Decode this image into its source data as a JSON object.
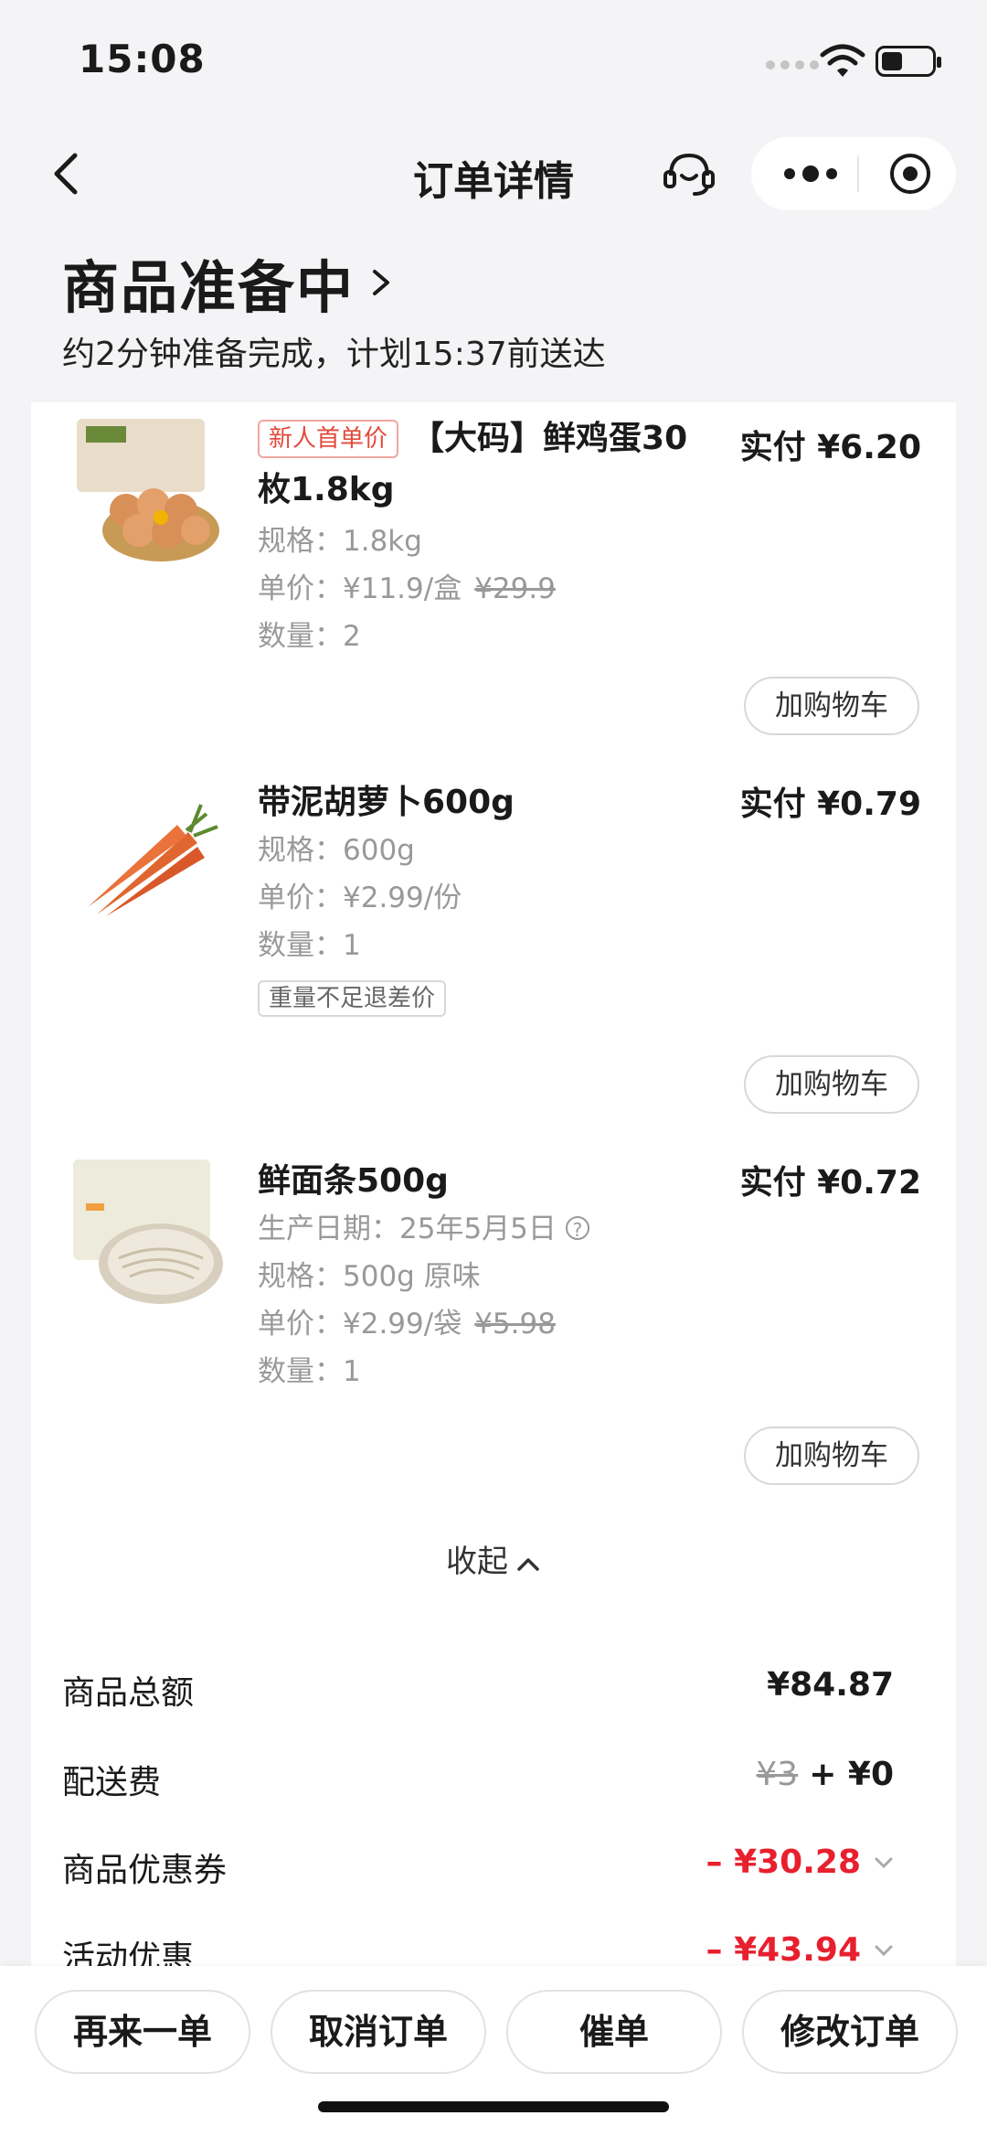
{
  "status_bar": {
    "time": "15:08"
  },
  "nav": {
    "title": "订单详情"
  },
  "order_status": {
    "title": "商品准备中",
    "subtitle": "约2分钟准备完成，计划15:37前送达"
  },
  "items": [
    {
      "tag": "新人首单价",
      "name": "【大码】鲜鸡蛋30枚1.8kg",
      "paid": "实付 ¥6.20",
      "spec": "规格：1.8kg",
      "unit_price": "单价：¥11.9/盒",
      "original_price": "¥29.9",
      "qty": "数量：2",
      "cart_label": "加购物车"
    },
    {
      "name": "带泥胡萝卜600g",
      "paid": "实付 ¥0.79",
      "spec": "规格：600g",
      "unit_price": "单价：¥2.99/份",
      "qty": "数量：1",
      "note_tag": "重量不足退差价",
      "cart_label": "加购物车"
    },
    {
      "name": "鲜面条500g",
      "paid": "实付 ¥0.72",
      "production_date": "生产日期：25年5月5日",
      "spec": "规格：500g 原味",
      "unit_price": "单价：¥2.99/袋",
      "original_price": "¥5.98",
      "qty": "数量：1",
      "cart_label": "加购物车"
    }
  ],
  "collapse_label": "收起",
  "summary": [
    {
      "label": "商品总额",
      "value": "¥84.87"
    },
    {
      "label": "配送费",
      "old": "¥3",
      "value": "+ ¥0"
    },
    {
      "label": "商品优惠券",
      "value": "– ¥30.28"
    },
    {
      "label": "活动优惠",
      "value": "– ¥43.94"
    }
  ],
  "actions": [
    "再来一单",
    "取消订单",
    "催单",
    "修改订单"
  ],
  "colors": {
    "red": "#e8202e",
    "tag_red": "#e24a3b",
    "background": "#f4f4f6"
  }
}
